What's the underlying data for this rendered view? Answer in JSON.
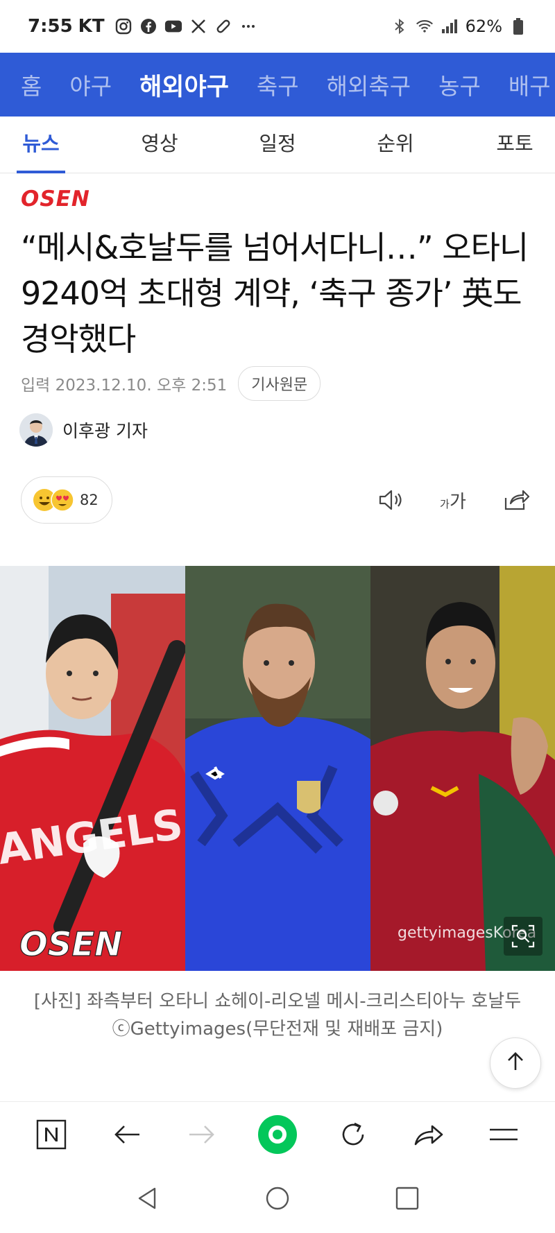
{
  "status_bar": {
    "time": "7:55",
    "carrier": "KT",
    "app_icons": [
      "instagram-icon",
      "facebook-icon",
      "youtube-icon",
      "x-icon",
      "link-icon",
      "more-icon"
    ],
    "battery": "62%"
  },
  "category_nav": {
    "items": [
      "홈",
      "야구",
      "해외야구",
      "축구",
      "해외축구",
      "농구",
      "배구"
    ],
    "active": "해외야구"
  },
  "sub_tabs": {
    "items": [
      "뉴스",
      "영상",
      "일정",
      "순위",
      "포토"
    ],
    "active": "뉴스"
  },
  "article": {
    "press": "OSEN",
    "headline": "“메시&호날두를 넘어서다니…” 오타니 9240억 초대형 계약, ‘축구 종가’ 英도 경악했다",
    "date": "입력 2023.12.10. 오후 2:51",
    "original_button": "기사원문",
    "reporter": "이후광 기자",
    "reaction_count": "82",
    "photo_watermarks": {
      "left": "OSEN",
      "right": "gettyimagesKorea"
    },
    "caption": "[사진] 좌측부터 오타니 쇼헤이-리오넬 메시-크리스티아누 호날두 ⓒGettyimages(무단전재 및 재배포 금지)"
  },
  "colors": {
    "brand_blue": "#2f5bd6",
    "osen_red": "#e2242b",
    "naver_green": "#03c75a"
  }
}
